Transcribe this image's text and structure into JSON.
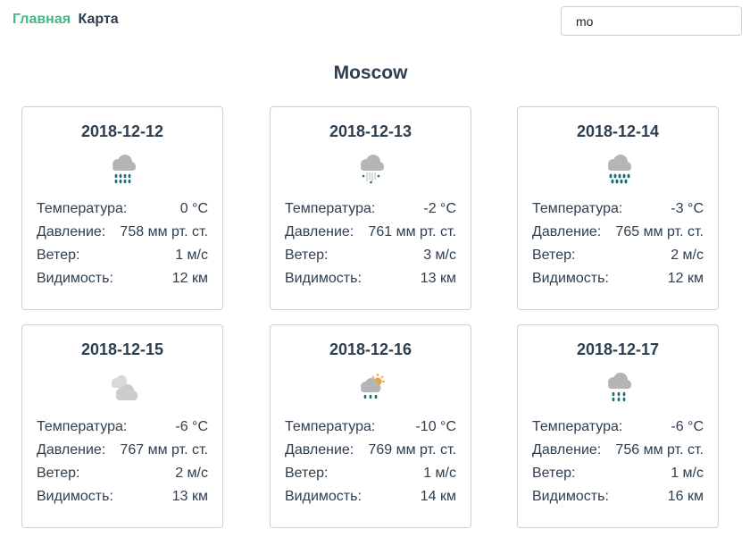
{
  "nav": {
    "home_label": "Главная",
    "map_label": "Карта"
  },
  "search": {
    "value": "mo"
  },
  "city": "Moscow",
  "labels": {
    "temperature": "Температура:",
    "pressure": "Давление:",
    "wind": "Ветер:",
    "visibility": "Видимость:"
  },
  "days": [
    {
      "date": "2018-12-12",
      "icon": "rain-icon",
      "temperature": "0 °C",
      "pressure": "758 мм рт. ст.",
      "wind": "1 м/с",
      "visibility": "12 км"
    },
    {
      "date": "2018-12-13",
      "icon": "sleet-icon",
      "temperature": "-2 °C",
      "pressure": "761 мм рт. ст.",
      "wind": "3 м/с",
      "visibility": "13 км"
    },
    {
      "date": "2018-12-14",
      "icon": "heavy-rain-icon",
      "temperature": "-3 °C",
      "pressure": "765 мм рт. ст.",
      "wind": "2 м/с",
      "visibility": "12 км"
    },
    {
      "date": "2018-12-15",
      "icon": "cloudy-icon",
      "temperature": "-6 °C",
      "pressure": "767 мм рт. ст.",
      "wind": "2 м/с",
      "visibility": "13 км"
    },
    {
      "date": "2018-12-16",
      "icon": "sun-rain-icon",
      "temperature": "-10 °C",
      "pressure": "769 мм рт. ст.",
      "wind": "1 м/с",
      "visibility": "14 км"
    },
    {
      "date": "2018-12-17",
      "icon": "light-rain-icon",
      "temperature": "-6 °C",
      "pressure": "756 мм рт. ст.",
      "wind": "1 м/с",
      "visibility": "16 км"
    }
  ],
  "colors": {
    "accent": "#42b983",
    "text": "#2c3e50",
    "cloud": "#b5b5b5",
    "drop": "#1b6e75",
    "sun": "#e8a33a"
  }
}
